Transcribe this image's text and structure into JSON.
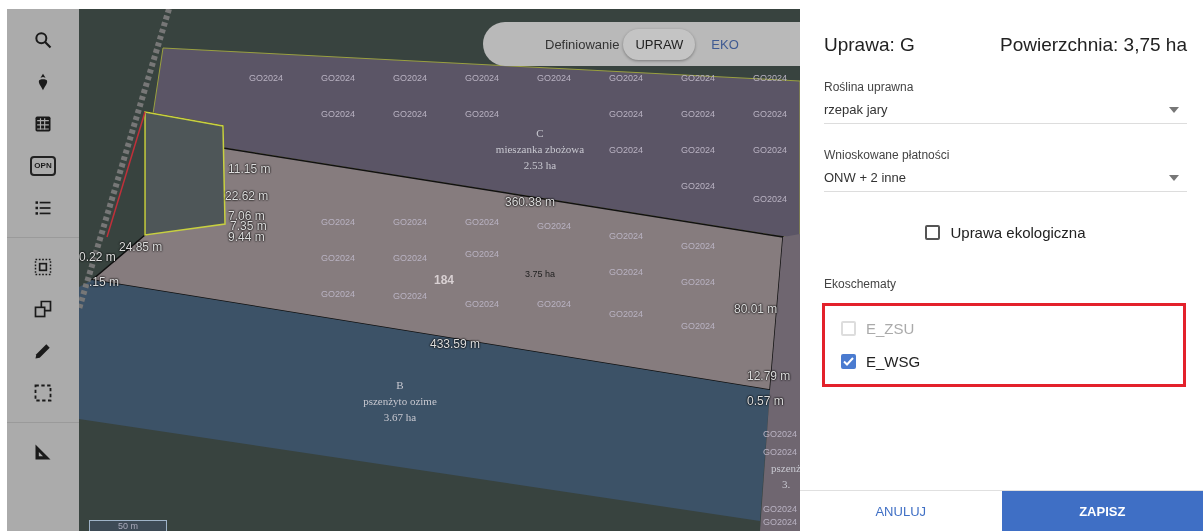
{
  "toolbar": {
    "tools": [
      {
        "kind": "search"
      },
      {
        "kind": "beet"
      },
      {
        "kind": "grid"
      },
      {
        "kind": "badge",
        "label": "OPN"
      },
      {
        "kind": "list"
      },
      {
        "kind": "divider"
      },
      {
        "kind": "select"
      },
      {
        "kind": "copy"
      },
      {
        "kind": "pencil"
      },
      {
        "kind": "frame"
      },
      {
        "kind": "divider"
      },
      {
        "kind": "ruler"
      }
    ]
  },
  "mode_switch": {
    "label": "Definiowanie",
    "options": [
      {
        "label": "UPRAW",
        "selected": true
      },
      {
        "label": "EKO",
        "selected": false
      }
    ]
  },
  "map": {
    "tile_labels": [
      "GO2024",
      "GO2024",
      "GO2024",
      "GO2024",
      "GO2024",
      "GO2024",
      "GO2024",
      "GO2024",
      "GO2024",
      "GO2024",
      "GO2024",
      "GO2024",
      "GO2024",
      "GO2024",
      "GO2024",
      "GO2024",
      "GO2024",
      "GO2024",
      "GO2024",
      "GO2024",
      "GO2024",
      "GO2024",
      "GO2024",
      "GO2024",
      "GO2024",
      "GO2024",
      "GO2024",
      "GO2024",
      "GO2024",
      "GO2024",
      "GO2024",
      "GO2024",
      "GO2024",
      "GO2024",
      "GO2024",
      "GO2024",
      "GO2024",
      "GO2024",
      "GO2024",
      "GO2024"
    ],
    "measurements": [
      "11.15 m",
      "22.62 m",
      "7.06 m",
      "7.35 m",
      "9.44 m",
      "24.85 m",
      "0.22 m",
      ".15 m",
      "360.38 m",
      "433.59 m",
      "80.01 m",
      "12.79 m",
      "0.57 m"
    ],
    "parcels": [
      {
        "lines": [
          "C",
          "mieszanka zbożowa",
          "2.53 ha"
        ]
      },
      {
        "lines": [
          "B",
          "pszenżyto ozime",
          "3.67 ha"
        ]
      },
      {
        "lines": [
          "pszenż",
          "3."
        ]
      }
    ],
    "parcel_number": "184",
    "selected_area": "3.75 ha",
    "scale": "50 m"
  },
  "panel": {
    "title": "Uprawa: G",
    "area": "Powierzchnia: 3,75 ha",
    "fields": [
      {
        "label": "Roślina uprawna",
        "value": "rzepak jary"
      },
      {
        "label": "Wnioskowane płatności",
        "value": "ONW + 2 inne"
      }
    ],
    "organic": {
      "label": "Uprawa ekologiczna",
      "checked": false
    },
    "eco_title": "Ekoschematy",
    "eco_schemes": [
      {
        "label": "E_ZSU",
        "checked": false,
        "disabled": true
      },
      {
        "label": "E_WSG",
        "checked": true,
        "disabled": false
      }
    ],
    "buttons": [
      {
        "label": "ANULUJ",
        "kind": "secondary"
      },
      {
        "label": "ZAPISZ",
        "kind": "primary"
      }
    ]
  }
}
